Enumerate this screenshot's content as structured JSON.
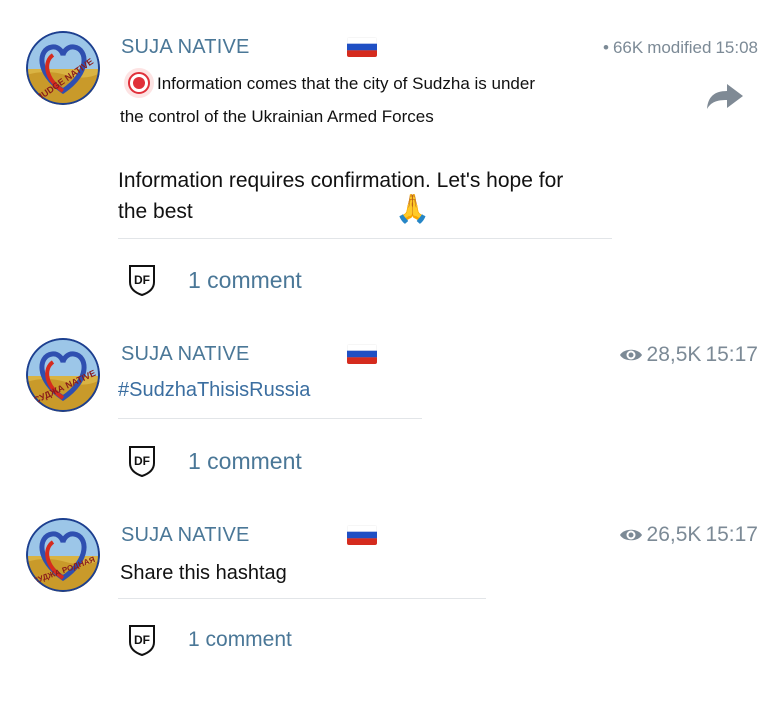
{
  "posts": [
    {
      "channel": "SUJA NATIVE",
      "views": "66K",
      "status": "modified",
      "time": "15:08",
      "bullet": "•",
      "body_line1": "Information comes that the city of Sudzha is under",
      "body_line2": "the control of the Ukrainian Armed Forces",
      "message_line1": "Information requires confirmation. Let's hope for",
      "message_line2": "the best",
      "emoji": "🙏",
      "comment": "1 comment",
      "avatar_text": "JUDGE NATIVE"
    },
    {
      "channel": "SUJA NATIVE",
      "views": "28,5K",
      "time": "15:17",
      "hashtag": "#SudzhaThisisRussia",
      "comment": "1 comment",
      "avatar_text": "СУДЖА NATIVE"
    },
    {
      "channel": "SUJA NATIVE",
      "views": "26,5K",
      "time": "15:17",
      "text": "Share this hashtag",
      "comment": "1 comment",
      "avatar_text": "СУДЖА РОДНАЯ"
    }
  ],
  "colors": {
    "channel_name": "#4a7797",
    "hashtag": "#3b6ea0",
    "meta": "#7c8a96",
    "flag_white": "#ffffff",
    "flag_blue": "#1f4fc4",
    "flag_red": "#d52b1e"
  },
  "icons": {
    "flag": "russia-flag-icon",
    "eye": "eye-icon",
    "forward": "forward-arrow-icon",
    "comments_logo": "df-logo-icon",
    "live": "red-circle-icon"
  }
}
